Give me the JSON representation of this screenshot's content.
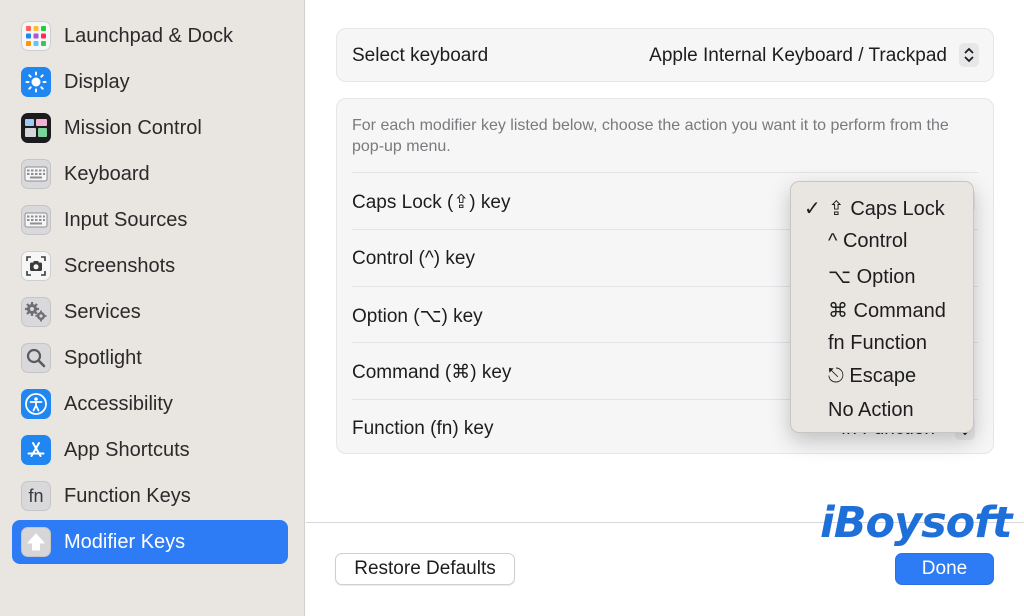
{
  "sidebar": {
    "items": [
      {
        "label": "Launchpad & Dock",
        "icon": "launchpad-icon"
      },
      {
        "label": "Display",
        "icon": "sun-icon"
      },
      {
        "label": "Mission Control",
        "icon": "mission-control-icon"
      },
      {
        "label": "Keyboard",
        "icon": "keyboard-icon"
      },
      {
        "label": "Input Sources",
        "icon": "keyboard-icon"
      },
      {
        "label": "Screenshots",
        "icon": "camera-icon"
      },
      {
        "label": "Services",
        "icon": "gears-icon"
      },
      {
        "label": "Spotlight",
        "icon": "magnifier-icon"
      },
      {
        "label": "Accessibility",
        "icon": "accessibility-icon"
      },
      {
        "label": "App Shortcuts",
        "icon": "app-store-icon"
      },
      {
        "label": "Function Keys",
        "icon": "fn-icon",
        "icon_text": "fn"
      },
      {
        "label": "Modifier Keys",
        "icon": "up-arrow-icon",
        "selected": true
      }
    ]
  },
  "keyboard_select": {
    "label": "Select keyboard",
    "value": "Apple Internal Keyboard / Trackpad"
  },
  "modifiers": {
    "description": "For each modifier key listed below, choose the action you want it to perform from the pop-up menu.",
    "rows": [
      {
        "label": "Caps Lock (⇪) key"
      },
      {
        "label": "Control (^) key"
      },
      {
        "label": "Option (⌥) key"
      },
      {
        "label": "Command (⌘) key"
      },
      {
        "label": "Function (fn) key",
        "value": "fn Function"
      }
    ]
  },
  "popup_menu": {
    "checkmark": "✓",
    "items": [
      {
        "label": "⇪ Caps Lock",
        "checked": true
      },
      {
        "label": "^ Control"
      },
      {
        "label": "⌥ Option"
      },
      {
        "label": "⌘ Command"
      },
      {
        "label": "fn Function"
      },
      {
        "label": "⎋ Escape"
      },
      {
        "label": "No Action"
      }
    ]
  },
  "footer": {
    "restore_label": "Restore Defaults",
    "done_label": "Done"
  },
  "watermark": "iBoysoft",
  "colors": {
    "accent": "#2d7cf6",
    "sidebar_bg": "#e9e6e2",
    "watermark": "#1f6fd9"
  }
}
